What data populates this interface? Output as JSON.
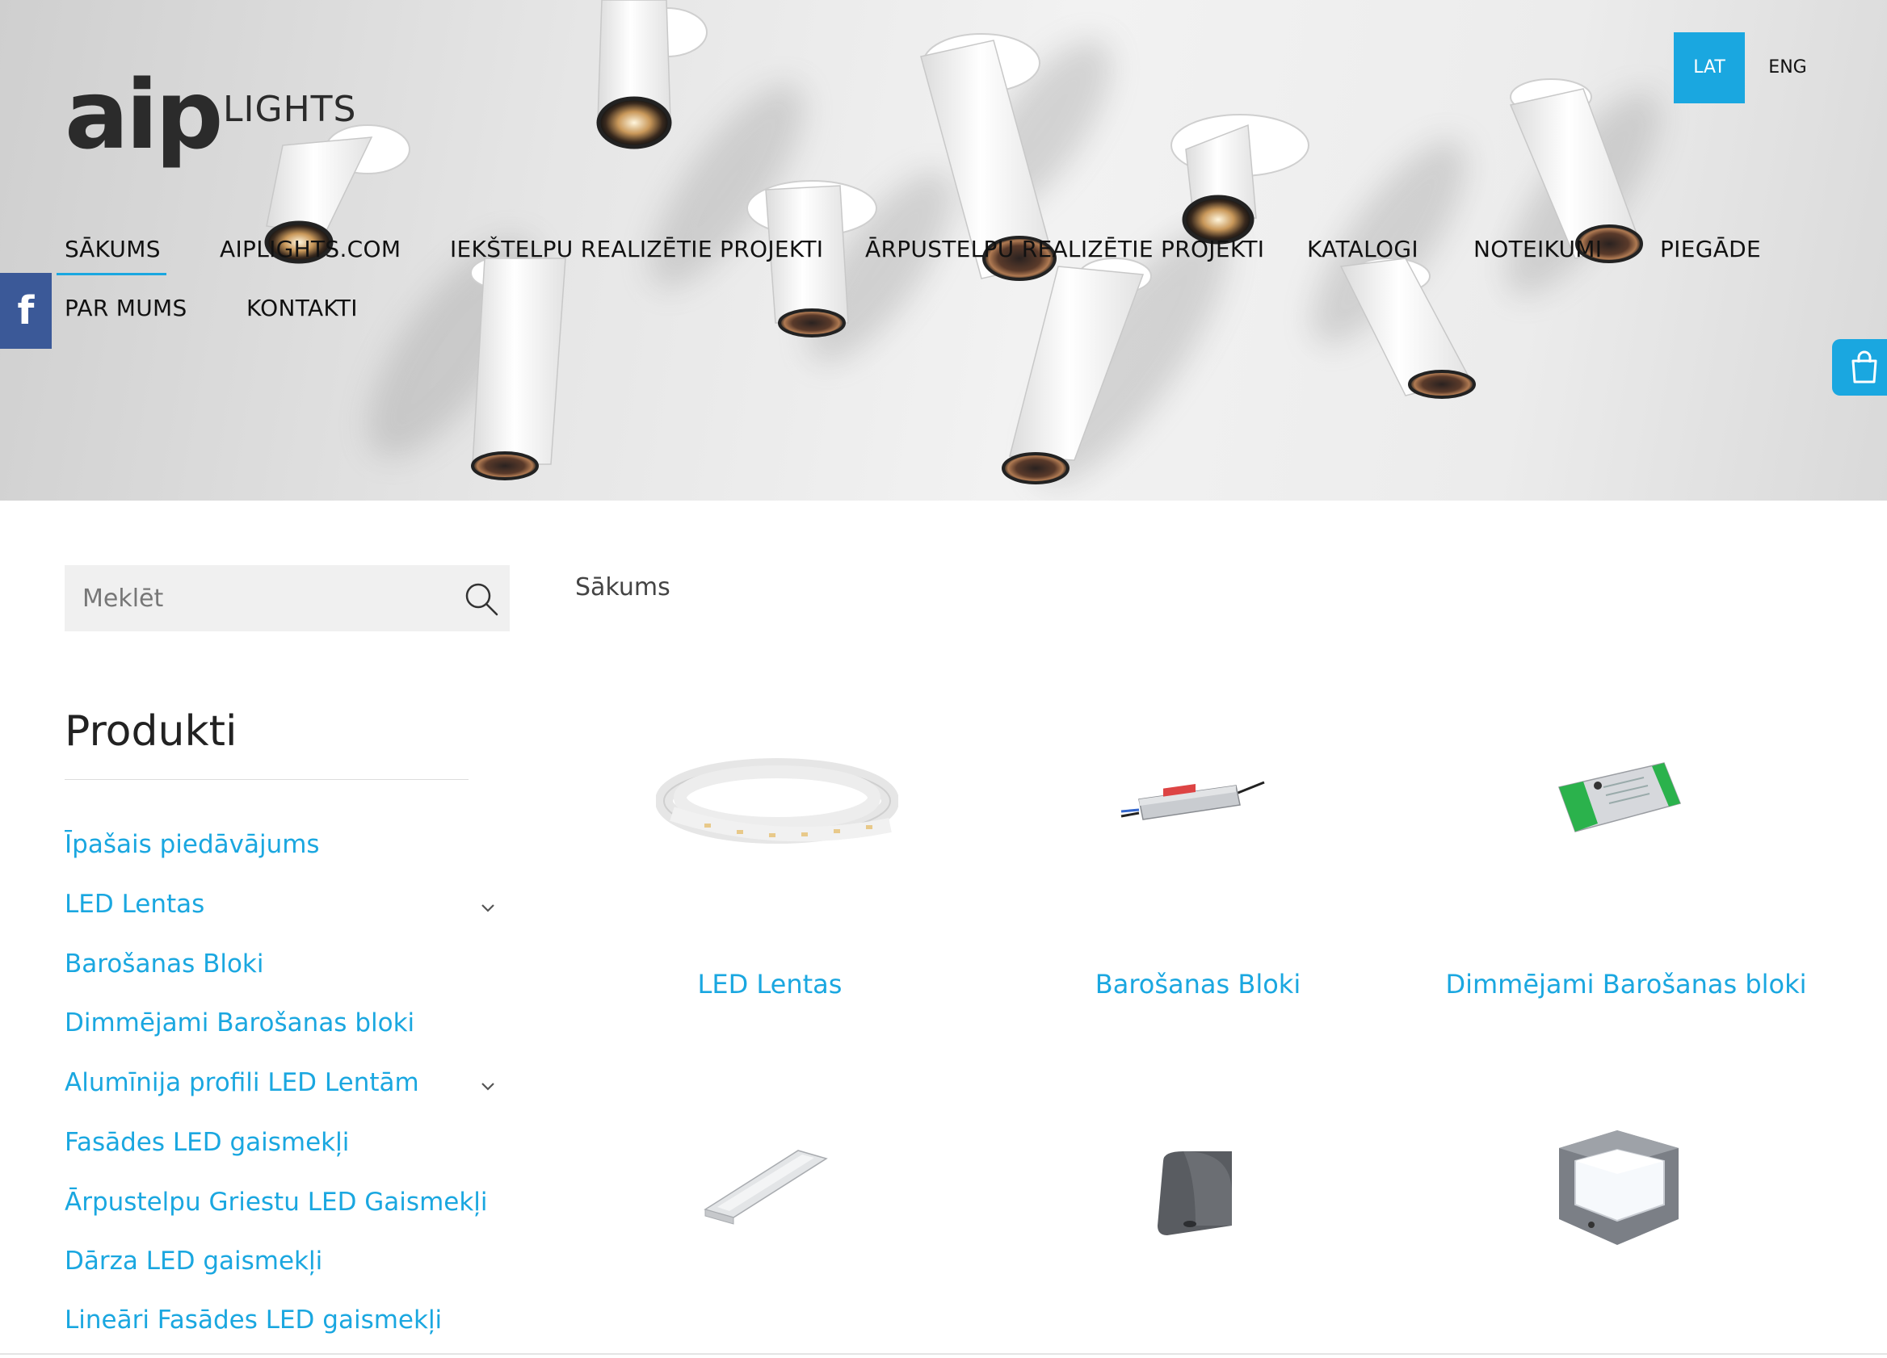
{
  "brand": {
    "logo_main": "aip",
    "logo_sub": "LIGHTS"
  },
  "languages": [
    {
      "label": "LAT",
      "active": true
    },
    {
      "label": "ENG",
      "active": false
    }
  ],
  "nav": [
    {
      "label": "SĀKUMS",
      "active": true
    },
    {
      "label": "AIPLIGHTS.COM"
    },
    {
      "label": "IEKŠTELPU REALIZĒTIE PROJEKTI"
    },
    {
      "label": "ĀRPUSTELPU REALIZĒTIE PROJEKTI"
    },
    {
      "label": "KATALOGI"
    },
    {
      "label": "NOTEIKUMI"
    },
    {
      "label": "PIEGĀDE"
    },
    {
      "label": "PAR MUMS"
    },
    {
      "label": "KONTAKTI"
    }
  ],
  "social": {
    "facebook_glyph": "f"
  },
  "search": {
    "placeholder": "Meklēt"
  },
  "sidebar": {
    "title": "Produkti",
    "items": [
      {
        "label": "Īpašais piedāvājums",
        "expandable": false
      },
      {
        "label": "LED Lentas",
        "expandable": true
      },
      {
        "label": "Barošanas Bloki",
        "expandable": false
      },
      {
        "label": "Dimmējami Barošanas bloki",
        "expandable": false
      },
      {
        "label": "Alumīnija profili LED Lentām",
        "expandable": true
      },
      {
        "label": "Fasādes LED gaismekļi",
        "expandable": false
      },
      {
        "label": "Ārpustelpu Griestu LED Gaismekļi",
        "expandable": false
      },
      {
        "label": "Dārza LED gaismekļi",
        "expandable": false
      },
      {
        "label": "Lineāri Fasādes LED gaismekļi",
        "expandable": false
      }
    ]
  },
  "breadcrumb": "Sākums",
  "categories": [
    {
      "label": "LED Lentas",
      "image": "led-strip"
    },
    {
      "label": "Barošanas Bloki",
      "image": "power-supply"
    },
    {
      "label": "Dimmējami Barošanas bloki",
      "image": "dimmable-power-supply"
    },
    {
      "label": "",
      "image": "aluminium-profile"
    },
    {
      "label": "",
      "image": "wall-light"
    },
    {
      "label": "",
      "image": "garden-light"
    }
  ],
  "colors": {
    "accent": "#1aa7e0",
    "facebook": "#3b5998",
    "text": "#111111"
  },
  "icons": [
    "search-icon",
    "cart-icon",
    "facebook-icon",
    "chevron-down-icon"
  ]
}
